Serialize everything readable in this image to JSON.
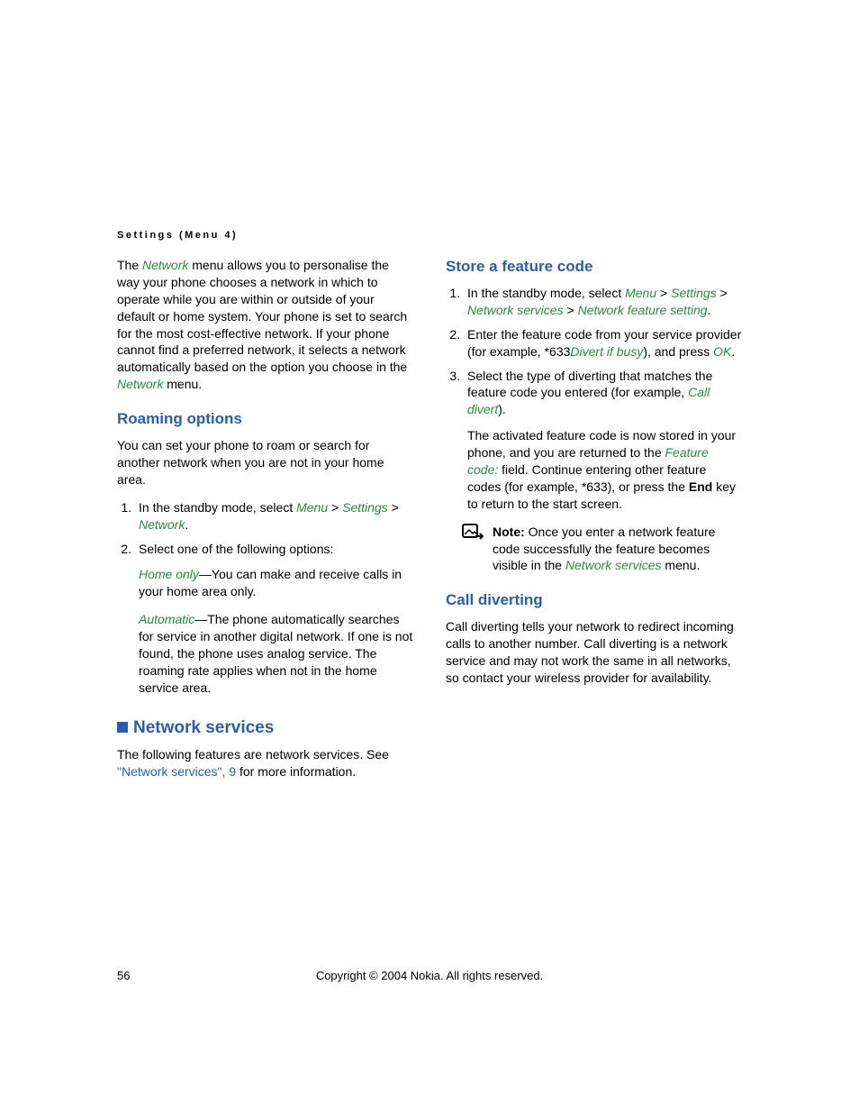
{
  "running_head": "Settings (Menu 4)",
  "left": {
    "intro_1": "The ",
    "intro_net": "Network",
    "intro_2": " menu allows you to personalise the way your phone chooses a network in which to operate while you are within or outside of your default or home system. Your phone is set to search for the most cost-effective network. If your phone cannot find a preferred network, it selects a network automatically based on the option you choose in the ",
    "intro_net2": "Network",
    "intro_3": " menu.",
    "roaming_h": "Roaming options",
    "roaming_p": "You can set your phone to roam or search for another network when you are not in your home area.",
    "roam_li1_a": "In the standby mode, select ",
    "menu": "Menu",
    "gt": " > ",
    "settings": "Settings",
    "network": "Network",
    "dot": ".",
    "roam_li2": "Select one of the following options:",
    "home_only": "Home only",
    "home_only_t": "—You can make and receive calls in your home area only.",
    "automatic": "Automatic",
    "automatic_t": "—The phone automatically searches for service in another digital network. If one is not found, the phone uses analog service. The roaming rate applies when not in the home service area.",
    "ns_h": "Network services",
    "ns_p1": "The following features are network services. See ",
    "ns_link": "\"Network services\", 9",
    "ns_p2": " for more information."
  },
  "right": {
    "store_h": "Store a feature code",
    "li1_a": "In the standby mode, select ",
    "menu": "Menu",
    "gt": " > ",
    "settings": "Settings",
    "ns": "Network services",
    "nfs": "Network feature setting",
    "dot": ".",
    "li2_a": "Enter the feature code from your service provider (for example, *633",
    "dib": "Divert if busy",
    "li2_b": "), and press ",
    "ok": "OK",
    "li3_a": "Select the type of diverting that matches the feature code you entered (for example, ",
    "cd": "Call divert",
    "li3_b": ").",
    "li3_p_a": "The activated feature code is now stored in your phone, and you are returned to the ",
    "fc": "Feature code:",
    "li3_p_b": " field. Continue entering other feature codes (for example, *633), or press the ",
    "end": "End",
    "li3_p_c": " key to return to the start screen.",
    "note_b": "Note:",
    "note_a": " Once you enter a network feature code successfully the feature becomes visible in the ",
    "note_ns": "Network services",
    "note_c": " menu.",
    "cd_h": "Call diverting",
    "cd_p": "Call diverting tells your network to redirect incoming calls to another number. Call diverting is a network service and may not work the same in all networks, so contact your wireless provider for availability."
  },
  "footer": {
    "page": "56",
    "copy": "Copyright © 2004 Nokia. All rights reserved."
  }
}
